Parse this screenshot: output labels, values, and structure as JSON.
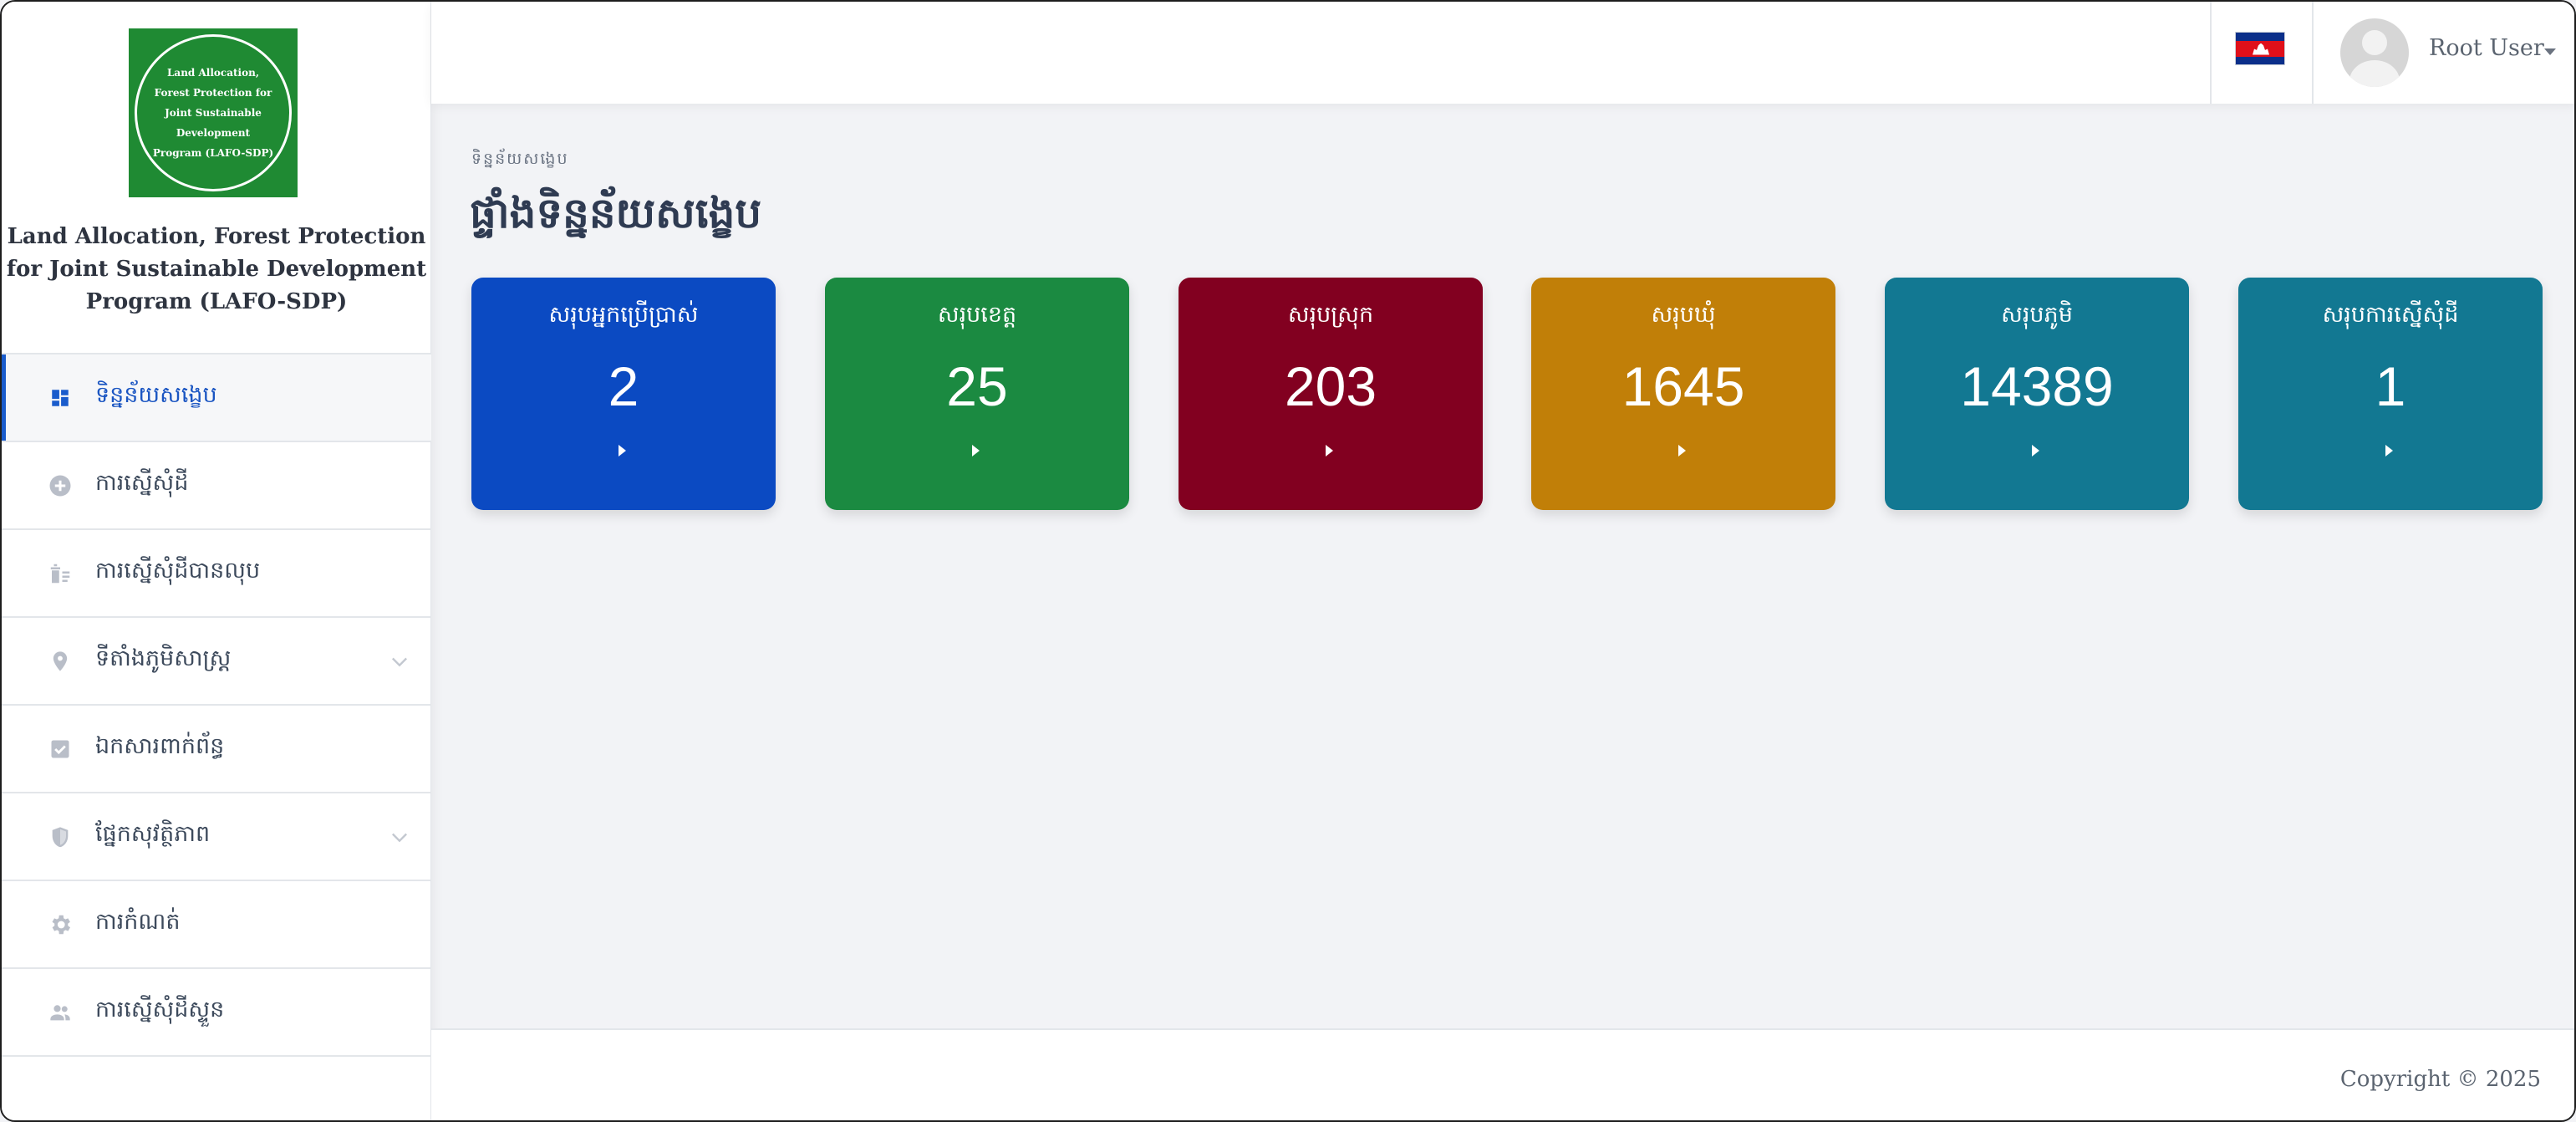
{
  "brand": {
    "logo_text": "Land Allocation, Forest Protection for Joint Sustainable Development Program (LAFO-SDP)",
    "title": "Land Allocation, Forest Protection for Joint Sustainable Development Program (LAFO-SDP)",
    "logo_color": "#1f8a33"
  },
  "sidebar": {
    "items": [
      {
        "label": "ទិន្នន័យសង្ខេប",
        "icon": "dashboard-icon",
        "active": true,
        "has_submenu": false
      },
      {
        "label": "ការស្នើសុំដី",
        "icon": "plus-circle-icon",
        "active": false,
        "has_submenu": false
      },
      {
        "label": "ការស្នើសុំដីបានលុប",
        "icon": "trash-list-icon",
        "active": false,
        "has_submenu": false
      },
      {
        "label": "ទីតាំងភូមិសាស្ត្រ",
        "icon": "map-pin-icon",
        "active": false,
        "has_submenu": true
      },
      {
        "label": "ឯកសារពាក់ព័ន្ធ",
        "icon": "checkbox-icon",
        "active": false,
        "has_submenu": false
      },
      {
        "label": "ផ្នែកសុវត្ថិភាព",
        "icon": "shield-icon",
        "active": false,
        "has_submenu": true
      },
      {
        "label": "ការកំណត់",
        "icon": "gear-icon",
        "active": false,
        "has_submenu": false
      },
      {
        "label": "ការស្នើសុំដីស្ទួន",
        "icon": "users-icon",
        "active": false,
        "has_submenu": false
      }
    ]
  },
  "topbar": {
    "flag": "cambodia-flag-icon",
    "user_name": "Root User"
  },
  "page": {
    "breadcrumb": "ទិន្នន័យសង្ខេប",
    "title": "ផ្ទាំងទិន្នន័យសង្ខេប"
  },
  "cards": [
    {
      "title": "សរុបអ្នកប្រើប្រាស់",
      "value": "2",
      "color": "#0b4ac2"
    },
    {
      "title": "សរុបខេត្ត",
      "value": "25",
      "color": "#1b8a41"
    },
    {
      "title": "សរុបស្រុក",
      "value": "203",
      "color": "#820020"
    },
    {
      "title": "សរុបឃុំ",
      "value": "1645",
      "color": "#c17f08"
    },
    {
      "title": "សរុបភូមិ",
      "value": "14389",
      "color": "#127892"
    },
    {
      "title": "សរុបការស្នើសុំដី",
      "value": "1",
      "color": "#127892"
    }
  ],
  "footer": {
    "copyright": "Copyright © 2025"
  },
  "colors": {
    "accent": "#1a5ccc",
    "page_bg": "#f2f3f6"
  }
}
